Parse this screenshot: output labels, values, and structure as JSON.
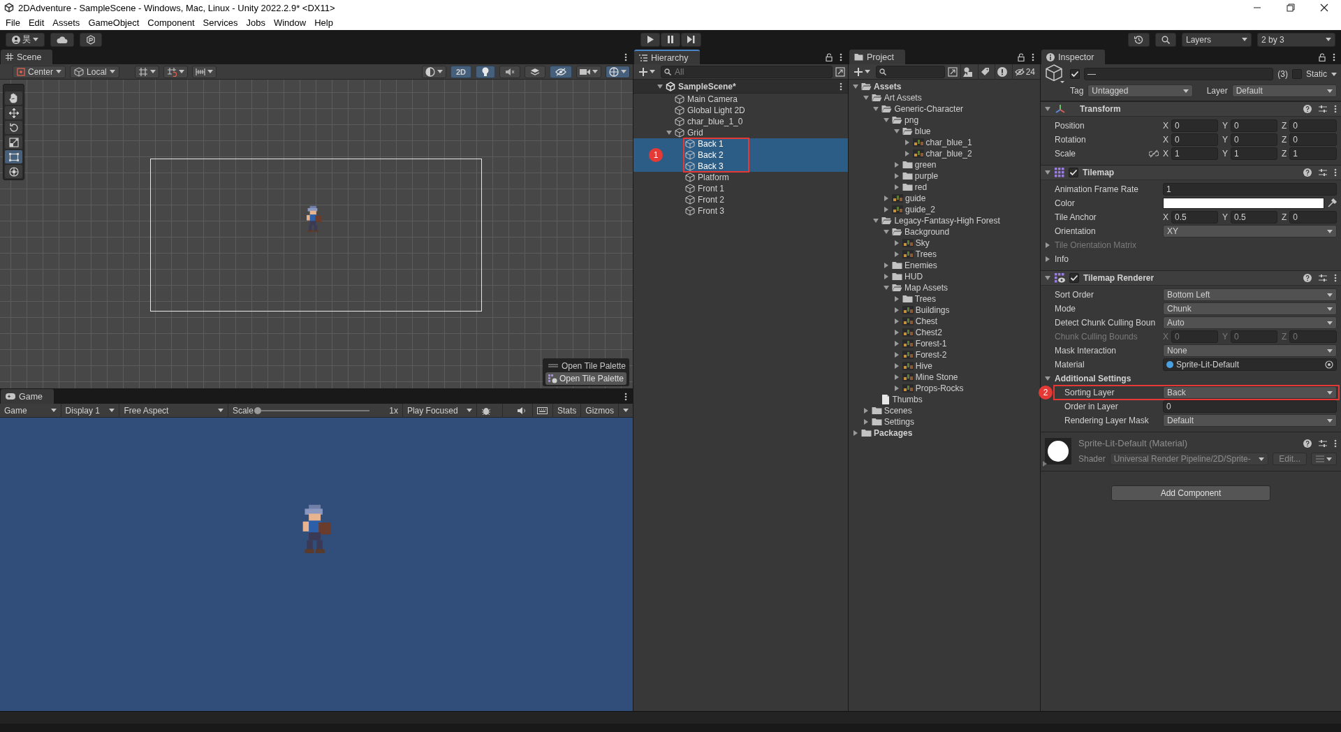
{
  "window": {
    "title": "2DAdventure - SampleScene - Windows, Mac, Linux - Unity 2022.2.9* <DX11>"
  },
  "menu": [
    "File",
    "Edit",
    "Assets",
    "GameObject",
    "Component",
    "Services",
    "Jobs",
    "Window",
    "Help"
  ],
  "toolbar": {
    "account": "昊",
    "layers": "Layers",
    "layout": "2 by 3"
  },
  "scene": {
    "tab": "Scene",
    "pivot": "Center",
    "space": "Local",
    "toggles": [
      {
        "kind": "dimension",
        "label": "2D",
        "on": true
      },
      {
        "kind": "lighting",
        "on": true
      },
      {
        "kind": "audio",
        "on": false
      },
      {
        "kind": "effects",
        "on": false
      },
      {
        "kind": "visibility",
        "on": true
      }
    ],
    "tools": [
      {
        "kind": "hand",
        "selected": false
      },
      {
        "kind": "move",
        "selected": false
      },
      {
        "kind": "rotate",
        "selected": false
      },
      {
        "kind": "scale",
        "selected": false
      },
      {
        "kind": "rect",
        "selected": true
      },
      {
        "kind": "transform",
        "selected": false
      }
    ],
    "overlay": {
      "title": "Open Tile Palette",
      "button": "Open Tile Palette"
    }
  },
  "game": {
    "tab": "Game",
    "view": "Game",
    "display": "Display 1",
    "aspect": "Free Aspect",
    "scale_label": "Scale",
    "scale": {
      "level": 0
    },
    "scale_reading": "1x",
    "play_mode": "Play Focused",
    "stats": "Stats",
    "gizmos": "Gizmos"
  },
  "hierarchy": {
    "tab": "Hierarchy",
    "search_placeholder": "All",
    "scene": "SampleScene*",
    "annotation": "1",
    "items": [
      {
        "name": "Main Camera",
        "selected": false
      },
      {
        "name": "Global Light 2D",
        "selected": false
      },
      {
        "name": "char_blue_1_0",
        "selected": false
      },
      {
        "name": "Grid",
        "selected": false,
        "expanded": true,
        "children": [
          {
            "name": "Back 1",
            "selected": true
          },
          {
            "name": "Back 2",
            "selected": true
          },
          {
            "name": "Back 3",
            "selected": true
          },
          {
            "name": "Platform",
            "selected": false
          },
          {
            "name": "Front 1",
            "selected": false
          },
          {
            "name": "Front 2",
            "selected": false
          },
          {
            "name": "Front 3",
            "selected": false
          }
        ]
      }
    ]
  },
  "project": {
    "tab": "Project",
    "hidden_count": "24",
    "tree": [
      {
        "name": "Assets",
        "kind": "folder",
        "expanded": true,
        "children": [
          {
            "name": "Art Assets",
            "kind": "folder",
            "expanded": true,
            "children": [
              {
                "name": "Generic-Character",
                "kind": "folder",
                "expanded": true,
                "children": [
                  {
                    "name": "png",
                    "kind": "folder",
                    "expanded": true,
                    "children": [
                      {
                        "name": "blue",
                        "kind": "folder",
                        "expanded": true,
                        "children": [
                          {
                            "name": "char_blue_1",
                            "kind": "sprite",
                            "expanded": false
                          },
                          {
                            "name": "char_blue_2",
                            "kind": "sprite",
                            "expanded": false
                          }
                        ]
                      },
                      {
                        "name": "green",
                        "kind": "folder",
                        "expanded": false
                      },
                      {
                        "name": "purple",
                        "kind": "folder",
                        "expanded": false
                      },
                      {
                        "name": "red",
                        "kind": "folder",
                        "expanded": false
                      }
                    ]
                  },
                  {
                    "name": "guide",
                    "kind": "sprite",
                    "expanded": false
                  },
                  {
                    "name": "guide_2",
                    "kind": "sprite",
                    "expanded": false
                  }
                ]
              },
              {
                "name": "Legacy-Fantasy-High Forest",
                "kind": "folder",
                "expanded": true,
                "children": [
                  {
                    "name": "Background",
                    "kind": "folder",
                    "expanded": true,
                    "children": [
                      {
                        "name": "Sky",
                        "kind": "sprite",
                        "expanded": false
                      },
                      {
                        "name": "Trees",
                        "kind": "sprite",
                        "expanded": false
                      }
                    ]
                  },
                  {
                    "name": "Enemies",
                    "kind": "folder",
                    "expanded": false
                  },
                  {
                    "name": "HUD",
                    "kind": "folder",
                    "expanded": false
                  },
                  {
                    "name": "Map Assets",
                    "kind": "folder",
                    "expanded": true,
                    "children": [
                      {
                        "name": "Trees",
                        "kind": "folder",
                        "expanded": false
                      },
                      {
                        "name": "Buildings",
                        "kind": "sprite",
                        "expanded": false
                      },
                      {
                        "name": "Chest",
                        "kind": "sprite",
                        "expanded": false
                      },
                      {
                        "name": "Chest2",
                        "kind": "sprite",
                        "expanded": false
                      },
                      {
                        "name": "Forest-1",
                        "kind": "sprite",
                        "expanded": false
                      },
                      {
                        "name": "Forest-2",
                        "kind": "sprite",
                        "expanded": false
                      },
                      {
                        "name": "Hive",
                        "kind": "sprite",
                        "expanded": false
                      },
                      {
                        "name": "Mine Stone",
                        "kind": "sprite",
                        "expanded": false
                      },
                      {
                        "name": "Props-Rocks",
                        "kind": "sprite",
                        "expanded": false
                      }
                    ]
                  }
                ]
              },
              {
                "name": "Thumbs",
                "kind": "file"
              }
            ]
          },
          {
            "name": "Scenes",
            "kind": "folder",
            "expanded": false
          },
          {
            "name": "Settings",
            "kind": "folder",
            "expanded": false
          }
        ]
      },
      {
        "name": "Packages",
        "kind": "folder",
        "expanded": false
      }
    ]
  },
  "inspector": {
    "tab": "Inspector",
    "object": {
      "active": true,
      "name": "—",
      "count": "(3)",
      "static": false,
      "static_label": "Static",
      "tag_label": "Tag",
      "tag": "Untagged",
      "layer_label": "Layer",
      "layer": "Default"
    },
    "components": [
      {
        "kind": "transform",
        "title": "Transform",
        "expanded": true,
        "properties": [
          {
            "kind": "vector",
            "label": "Position",
            "disabled": false,
            "values": [
              {
                "axis": "X",
                "value": "0"
              },
              {
                "axis": "Y",
                "value": "0"
              },
              {
                "axis": "Z",
                "value": "0"
              }
            ]
          },
          {
            "kind": "vector",
            "label": "Rotation",
            "disabled": false,
            "values": [
              {
                "axis": "X",
                "value": "0"
              },
              {
                "axis": "Y",
                "value": "0"
              },
              {
                "axis": "Z",
                "value": "0"
              }
            ]
          },
          {
            "kind": "vector",
            "label": "Scale",
            "disabled": false,
            "linked": false,
            "values": [
              {
                "axis": "X",
                "value": "1"
              },
              {
                "axis": "Y",
                "value": "1"
              },
              {
                "axis": "Z",
                "value": "1"
              }
            ]
          }
        ]
      },
      {
        "kind": "tilemap",
        "title": "Tilemap",
        "expanded": true,
        "enabled": true,
        "properties": [
          {
            "kind": "number",
            "label": "Animation Frame Rate",
            "disabled": false,
            "value": "1"
          },
          {
            "kind": "color",
            "label": "Color",
            "disabled": false,
            "color": "#ffffff"
          },
          {
            "kind": "vector",
            "label": "Tile Anchor",
            "disabled": false,
            "values": [
              {
                "axis": "X",
                "value": "0.5"
              },
              {
                "axis": "Y",
                "value": "0.5"
              },
              {
                "axis": "Z",
                "value": "0"
              }
            ]
          },
          {
            "kind": "dropdown",
            "label": "Orientation",
            "disabled": false,
            "value": "XY"
          },
          {
            "kind": "foldout",
            "label": "Tile Orientation Matrix",
            "disabled": true,
            "expanded": false
          },
          {
            "kind": "foldout",
            "label": "Info",
            "disabled": false,
            "expanded": false
          }
        ]
      },
      {
        "kind": "tilemap_renderer",
        "title": "Tilemap Renderer",
        "expanded": true,
        "enabled": true,
        "properties": [
          {
            "kind": "dropdown",
            "label": "Sort Order",
            "disabled": false,
            "value": "Bottom Left"
          },
          {
            "kind": "dropdown",
            "label": "Mode",
            "disabled": false,
            "value": "Chunk"
          },
          {
            "kind": "dropdown",
            "label": "Detect Chunk Culling Boun",
            "disabled": false,
            "value": "Auto"
          },
          {
            "kind": "vector",
            "label": "Chunk Culling Bounds",
            "disabled": true,
            "values": [
              {
                "axis": "X",
                "value": "0"
              },
              {
                "axis": "Y",
                "value": "0"
              },
              {
                "axis": "Z",
                "value": "0"
              }
            ]
          },
          {
            "kind": "dropdown",
            "label": "Mask Interaction",
            "disabled": false,
            "value": "None"
          },
          {
            "kind": "object",
            "label": "Material",
            "disabled": false,
            "value": "Sprite-Lit-Default"
          },
          {
            "kind": "foldout",
            "label": "Additional Settings",
            "disabled": false,
            "expanded": true,
            "children": [
              {
                "kind": "dropdown",
                "label": "Sorting Layer",
                "disabled": false,
                "value": "Back",
                "annotation": "2"
              },
              {
                "kind": "number",
                "label": "Order in Layer",
                "disabled": false,
                "value": "0"
              },
              {
                "kind": "dropdown",
                "label": "Rendering Layer Mask",
                "disabled": false,
                "value": "Default"
              }
            ]
          }
        ]
      }
    ],
    "material": {
      "title": "Sprite-Lit-Default (Material)",
      "shader_label": "Shader",
      "shader": "Universal Render Pipeline/2D/Sprite-",
      "edit": "Edit..."
    },
    "add_component": "Add Component"
  }
}
